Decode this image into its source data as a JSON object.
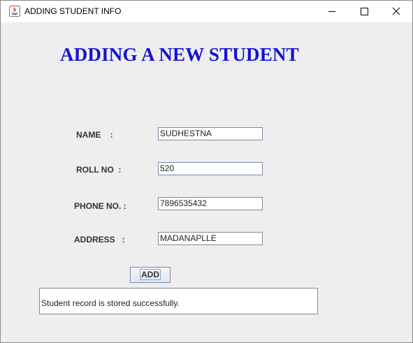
{
  "window": {
    "title": "ADDING STUDENT INFO",
    "controls": {
      "minimize": "minimize-icon",
      "maximize": "maximize-icon",
      "close": "close-icon"
    }
  },
  "form": {
    "heading": "ADDING A NEW STUDENT",
    "heading_color": "#1212d6",
    "fields": {
      "name": {
        "label": "NAME    :",
        "value": "SUDHESTNA"
      },
      "roll_no": {
        "label": "ROLL NO  :",
        "value": "520"
      },
      "phone": {
        "label": "PHONE NO. :",
        "value": "7896535432"
      },
      "address": {
        "label": "ADDRESS   :",
        "value": "MADANAPLLE"
      }
    },
    "add_button_label": "ADD",
    "status_message": "Student record is stored successfully."
  }
}
